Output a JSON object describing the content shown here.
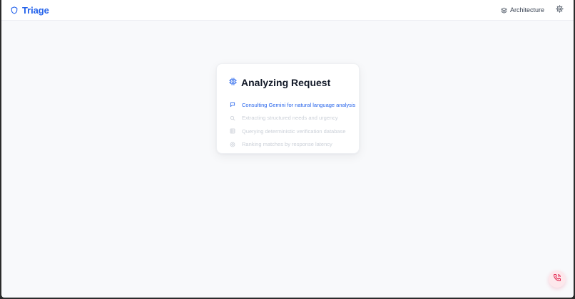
{
  "header": {
    "brand": "Triage",
    "architecture_label": "Architecture"
  },
  "card": {
    "title": "Analyzing Request",
    "steps": [
      {
        "label": "Consulting Gemini for natural language analysis",
        "status": "active",
        "icon": "message-icon"
      },
      {
        "label": "Extracting structured needs and urgency",
        "status": "pending",
        "icon": "search-icon"
      },
      {
        "label": "Querying deterministic verification database",
        "status": "pending",
        "icon": "database-icon"
      },
      {
        "label": "Ranking matches by response latency",
        "status": "pending",
        "icon": "target-icon"
      }
    ]
  },
  "colors": {
    "accent": "#2563eb",
    "pending": "#cbd0d8",
    "fab_bg": "#fde8ec",
    "fab_icon": "#e11d48"
  }
}
